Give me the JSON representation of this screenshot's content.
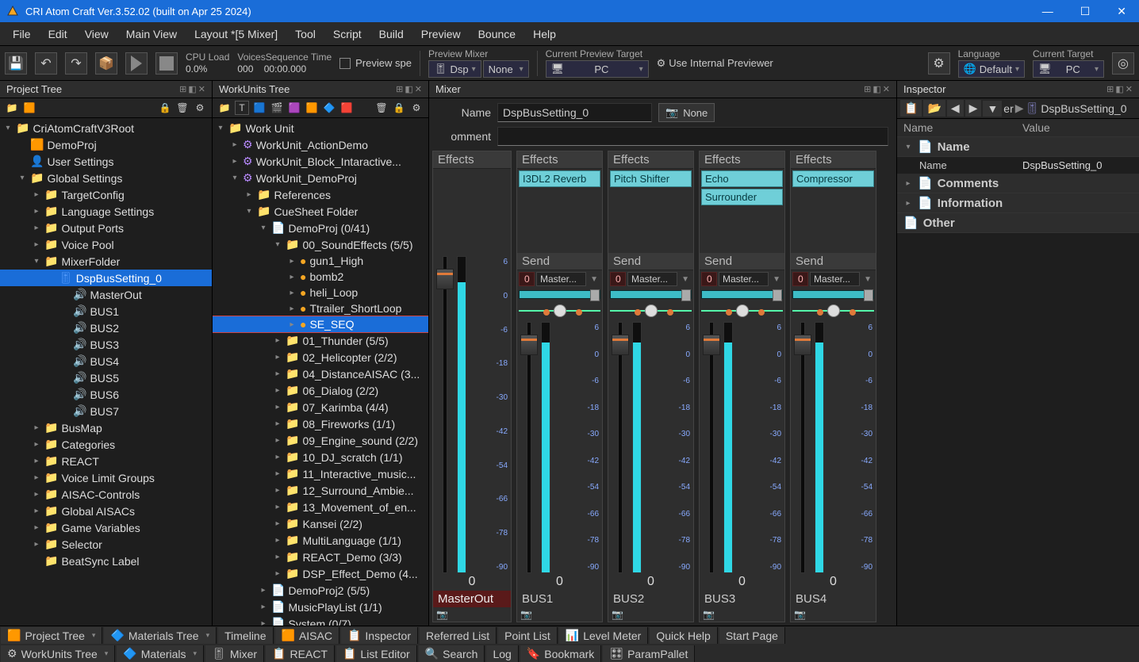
{
  "title": "CRI Atom Craft Ver.3.52.02 (built on Apr 25 2024)",
  "menubar": [
    "File",
    "Edit",
    "View",
    "Main View",
    "Layout *[5 Mixer]",
    "Tool",
    "Script",
    "Build",
    "Preview",
    "Bounce",
    "Help"
  ],
  "toolbar": {
    "cpu_label": "CPU Load",
    "cpu_value": "0.0%",
    "voices_label": "Voices",
    "voices_value": "000",
    "seqtime_label": "Sequence Time",
    "seqtime_value": "00:00.000",
    "preview_spe": "Preview spe",
    "preview_mixer_label": "Preview Mixer",
    "preview_mixer_dsp": "Dsp",
    "preview_mixer_none": "None",
    "current_preview_label": "Current Preview Target",
    "current_preview_value": "PC",
    "use_internal": "Use Internal Previewer",
    "language_label": "Language",
    "language_value": "Default",
    "current_target_label": "Current Target",
    "current_target_value": "PC"
  },
  "panels": {
    "project_tree": "Project Tree",
    "workunits_tree": "WorkUnits Tree",
    "mixer": "Mixer",
    "inspector": "Inspector"
  },
  "project_tree": {
    "root": "CriAtomCraftV3Root",
    "items": [
      {
        "label": "DemoProj",
        "icon": "orange",
        "indent": 1
      },
      {
        "label": "User Settings",
        "icon": "blue-user",
        "indent": 1
      },
      {
        "label": "Global Settings",
        "icon": "folder",
        "indent": 1,
        "expand": true
      },
      {
        "label": "TargetConfig",
        "icon": "folder",
        "indent": 2,
        "tw": true
      },
      {
        "label": "Language Settings",
        "icon": "folder",
        "indent": 2,
        "tw": true
      },
      {
        "label": "Output Ports",
        "icon": "folder",
        "indent": 2,
        "tw": true
      },
      {
        "label": "Voice Pool",
        "icon": "folder",
        "indent": 2,
        "tw": true
      },
      {
        "label": "MixerFolder",
        "icon": "folder",
        "indent": 2,
        "expand": true
      },
      {
        "label": "DspBusSetting_0",
        "icon": "blue-set",
        "indent": 3,
        "sel": true
      },
      {
        "label": "MasterOut",
        "icon": "blue-bus",
        "indent": 4
      },
      {
        "label": "BUS1",
        "icon": "blue-bus",
        "indent": 4
      },
      {
        "label": "BUS2",
        "icon": "blue-bus",
        "indent": 4
      },
      {
        "label": "BUS3",
        "icon": "blue-bus",
        "indent": 4
      },
      {
        "label": "BUS4",
        "icon": "blue-bus",
        "indent": 4
      },
      {
        "label": "BUS5",
        "icon": "blue-bus",
        "indent": 4
      },
      {
        "label": "BUS6",
        "icon": "blue-bus",
        "indent": 4
      },
      {
        "label": "BUS7",
        "icon": "blue-bus",
        "indent": 4
      },
      {
        "label": "BusMap",
        "icon": "folder",
        "indent": 2,
        "tw": true
      },
      {
        "label": "Categories",
        "icon": "folder",
        "indent": 2,
        "tw": true
      },
      {
        "label": "REACT",
        "icon": "folder",
        "indent": 2,
        "tw": true
      },
      {
        "label": "Voice Limit Groups",
        "icon": "folder",
        "indent": 2,
        "tw": true
      },
      {
        "label": "AISAC-Controls",
        "icon": "folder",
        "indent": 2,
        "tw": true
      },
      {
        "label": "Global AISACs",
        "icon": "folder",
        "indent": 2,
        "tw": true
      },
      {
        "label": "Game Variables",
        "icon": "folder",
        "indent": 2,
        "tw": true
      },
      {
        "label": "Selector",
        "icon": "folder",
        "indent": 2,
        "tw": true
      },
      {
        "label": "BeatSync Label",
        "icon": "folder",
        "indent": 2
      }
    ]
  },
  "workunits_tree": {
    "root": "Work Unit",
    "items": [
      {
        "label": "WorkUnit_ActionDemo",
        "icon": "purple",
        "indent": 1,
        "tw": true
      },
      {
        "label": "WorkUnit_Block_Intaractive...",
        "icon": "purple",
        "indent": 1,
        "tw": true
      },
      {
        "label": "WorkUnit_DemoProj",
        "icon": "purple",
        "indent": 1,
        "expand": true
      },
      {
        "label": "References",
        "icon": "folder",
        "indent": 2,
        "tw": true
      },
      {
        "label": "CueSheet Folder",
        "icon": "folder-y",
        "indent": 2,
        "expand": true
      },
      {
        "label": "DemoProj (0/41)",
        "icon": "sheet",
        "indent": 3,
        "expand": true
      },
      {
        "label": "00_SoundEffects (5/5)",
        "icon": "folder-g",
        "indent": 4,
        "expand": true
      },
      {
        "label": "gun1_High",
        "icon": "ball",
        "indent": 5,
        "tw": true
      },
      {
        "label": "bomb2",
        "icon": "ball",
        "indent": 5,
        "tw": true
      },
      {
        "label": "heli_Loop",
        "icon": "ball",
        "indent": 5,
        "tw": true
      },
      {
        "label": "Ttrailer_ShortLoop",
        "icon": "ball",
        "indent": 5,
        "tw": true
      },
      {
        "label": "SE_SEQ",
        "icon": "ball",
        "indent": 5,
        "tw": true,
        "selred": true
      },
      {
        "label": "01_Thunder (5/5)",
        "icon": "folder-g",
        "indent": 4,
        "tw": true
      },
      {
        "label": "02_Helicopter (2/2)",
        "icon": "folder-g",
        "indent": 4,
        "tw": true
      },
      {
        "label": "04_DistanceAISAC (3...",
        "icon": "folder-g",
        "indent": 4,
        "tw": true
      },
      {
        "label": "06_Dialog (2/2)",
        "icon": "folder-g",
        "indent": 4,
        "tw": true
      },
      {
        "label": "07_Karimba (4/4)",
        "icon": "folder-g",
        "indent": 4,
        "tw": true
      },
      {
        "label": "08_Fireworks (1/1)",
        "icon": "folder-g",
        "indent": 4,
        "tw": true
      },
      {
        "label": "09_Engine_sound (2/2)",
        "icon": "folder-g",
        "indent": 4,
        "tw": true
      },
      {
        "label": "10_DJ_scratch (1/1)",
        "icon": "folder-g",
        "indent": 4,
        "tw": true
      },
      {
        "label": "11_Interactive_music...",
        "icon": "folder-g",
        "indent": 4,
        "tw": true
      },
      {
        "label": "12_Surround_Ambie...",
        "icon": "folder-g",
        "indent": 4,
        "tw": true
      },
      {
        "label": "13_Movement_of_en...",
        "icon": "folder-g",
        "indent": 4,
        "tw": true
      },
      {
        "label": "Kansei (2/2)",
        "icon": "folder-g",
        "indent": 4,
        "tw": true
      },
      {
        "label": "MultiLanguage (1/1)",
        "icon": "folder-g",
        "indent": 4,
        "tw": true
      },
      {
        "label": "REACT_Demo (3/3)",
        "icon": "folder-g",
        "indent": 4,
        "tw": true
      },
      {
        "label": "DSP_Effect_Demo (4...",
        "icon": "folder-g",
        "indent": 4,
        "tw": true
      },
      {
        "label": "DemoProj2 (5/5)",
        "icon": "sheet",
        "indent": 3,
        "tw": true
      },
      {
        "label": "MusicPlayList (1/1)",
        "icon": "sheet",
        "indent": 3,
        "tw": true
      },
      {
        "label": "System (0/7)",
        "icon": "sheet",
        "indent": 3,
        "tw": true
      }
    ]
  },
  "mixer": {
    "name_label": "Name",
    "name_value": "DspBusSetting_0",
    "none": "None",
    "comment_label": "omment",
    "comment_value": "",
    "effects_h": "Effects",
    "send_h": "Send",
    "scale": [
      "6",
      "0",
      "-6",
      "-18",
      "-30",
      "-42",
      "-54",
      "-66",
      "-78",
      "-90"
    ],
    "strips": [
      {
        "name": "MasterOut",
        "master": true,
        "val": "0",
        "fx": []
      },
      {
        "name": "BUS1",
        "val": "0",
        "fx": [
          "I3DL2 Reverb"
        ],
        "send_val": "0",
        "send_tgt": "Master..."
      },
      {
        "name": "BUS2",
        "val": "0",
        "fx": [
          "Pitch Shifter"
        ],
        "send_val": "0",
        "send_tgt": "Master..."
      },
      {
        "name": "BUS3",
        "val": "0",
        "fx": [
          "Echo",
          "Surrounder"
        ],
        "send_val": "0",
        "send_tgt": "Master..."
      },
      {
        "name": "BUS4",
        "val": "0",
        "fx": [
          "Compressor"
        ],
        "send_val": "0",
        "send_tgt": "Master..."
      }
    ]
  },
  "inspector": {
    "crumb": "DspBusSetting_0",
    "crumb_pre": "er",
    "name_h": "Name",
    "value_h": "Value",
    "cats": [
      {
        "label": "Name",
        "open": true,
        "rows": [
          {
            "k": "Name",
            "v": "DspBusSetting_0"
          }
        ]
      },
      {
        "label": "Comments",
        "open": false
      },
      {
        "label": "Information",
        "open": false
      },
      {
        "label": "Other",
        "open": false,
        "notw": true
      }
    ]
  },
  "bottom_tabs_row1": [
    {
      "label": "Project Tree",
      "icon": "🟧",
      "dd": true
    },
    {
      "label": "Materials Tree",
      "icon": "🔷",
      "dd": true
    },
    {
      "label": "Timeline",
      "icon": ""
    },
    {
      "label": "AISAC",
      "icon": "🟧"
    },
    {
      "label": "Inspector",
      "icon": "📋"
    },
    {
      "label": "Referred List",
      "icon": ""
    },
    {
      "label": "Point List",
      "icon": ""
    },
    {
      "label": "Level Meter",
      "icon": "📊"
    },
    {
      "label": "Quick Help",
      "icon": ""
    },
    {
      "label": "Start Page",
      "icon": ""
    }
  ],
  "bottom_tabs_row2": [
    {
      "label": "WorkUnits Tree",
      "icon": "⚙",
      "dd": true
    },
    {
      "label": "Materials",
      "icon": "🔷",
      "dd": true
    },
    {
      "label": "Mixer",
      "icon": "🎚"
    },
    {
      "label": "REACT",
      "icon": "📋"
    },
    {
      "label": "List Editor",
      "icon": "📋"
    },
    {
      "label": "Search",
      "icon": "🔍"
    },
    {
      "label": "Log",
      "icon": ""
    },
    {
      "label": "Bookmark",
      "icon": "🔖"
    },
    {
      "label": "ParamPallet",
      "icon": "🎛"
    }
  ]
}
